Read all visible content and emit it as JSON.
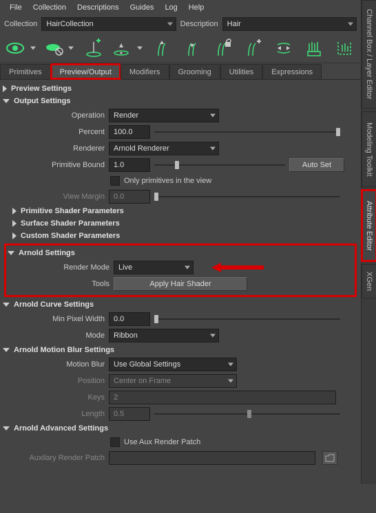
{
  "menubar": [
    "File",
    "Collection",
    "Descriptions",
    "Guides",
    "Log",
    "Help"
  ],
  "collection": {
    "col_label": "Collection",
    "col_value": "HairCollection",
    "desc_label": "Description",
    "desc_value": "Hair"
  },
  "tabs": {
    "t0": "Primitives",
    "t1": "Preview/Output",
    "t2": "Modifiers",
    "t3": "Grooming",
    "t4": "Utilities",
    "t5": "Expressions"
  },
  "sections": {
    "preview": "Preview Settings",
    "output": "Output Settings",
    "prim_shader": "Primitive Shader Parameters",
    "surf_shader": "Surface Shader Parameters",
    "cust_shader": "Custom Shader Parameters",
    "arnold": "Arnold Settings",
    "arnold_curve": "Arnold Curve Settings",
    "arnold_mb": "Arnold Motion Blur Settings",
    "arnold_adv": "Arnold Advanced Settings"
  },
  "output": {
    "operation_label": "Operation",
    "operation_value": "Render",
    "percent_label": "Percent",
    "percent_value": "100.0",
    "renderer_label": "Renderer",
    "renderer_value": "Arnold Renderer",
    "primbound_label": "Primitive Bound",
    "primbound_value": "1.0",
    "autoset_label": "Auto Set",
    "only_prim_label": "Only primitives in the view",
    "viewmargin_label": "View Margin",
    "viewmargin_value": "0.0"
  },
  "arnold": {
    "rendermode_label": "Render Mode",
    "rendermode_value": "Live",
    "tools_label": "Tools",
    "apply_label": "Apply Hair Shader"
  },
  "curve": {
    "minpx_label": "Min Pixel Width",
    "minpx_value": "0.0",
    "mode_label": "Mode",
    "mode_value": "Ribbon"
  },
  "mb": {
    "mb_label": "Motion Blur",
    "mb_value": "Use Global Settings",
    "pos_label": "Position",
    "pos_value": "Center on Frame",
    "keys_label": "Keys",
    "keys_value": "2",
    "len_label": "Length",
    "len_value": "0.5"
  },
  "adv": {
    "useaux_label": "Use Aux Render Patch",
    "aux_label": "Auxilary Render Patch"
  },
  "side": {
    "s0": "Channel Box / Layer Editor",
    "s1": "Modeling Toolkit",
    "s2": "Attribute Editor",
    "s3": "XGen"
  }
}
